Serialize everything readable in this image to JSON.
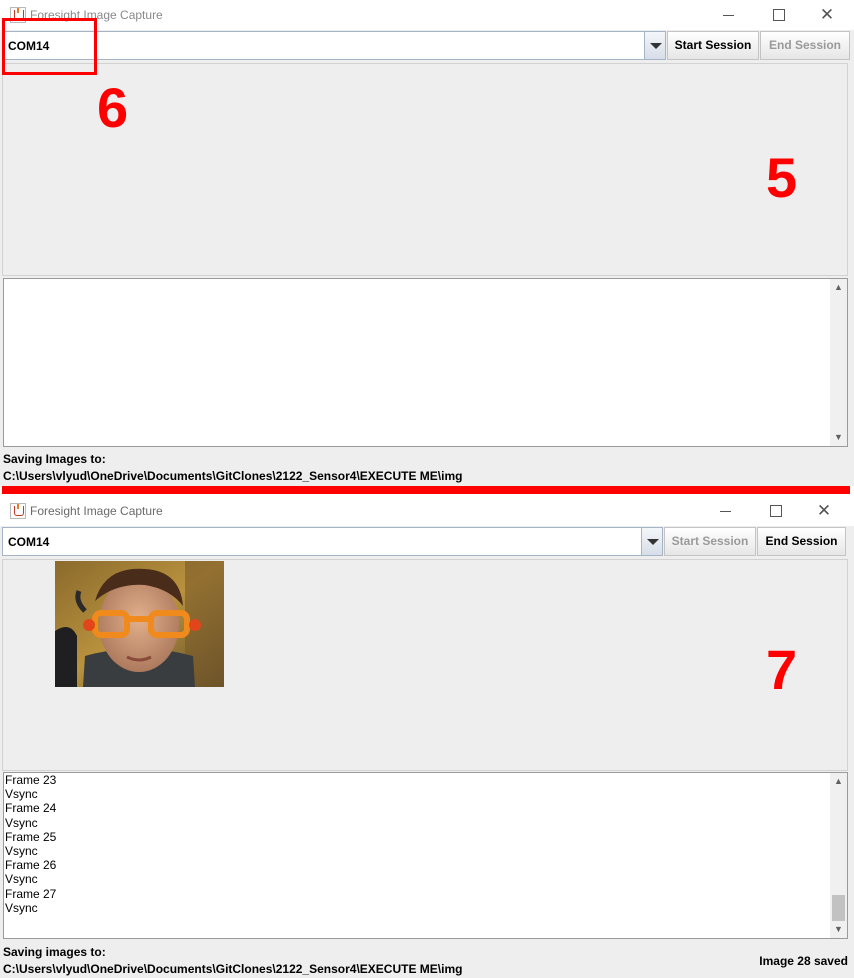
{
  "window_top": {
    "title": "Foresight Image Capture",
    "port_select": {
      "value": "COM14"
    },
    "start_button": "Start Session",
    "end_button": "End Session",
    "log_lines": [],
    "saving_label": "Saving Images to:",
    "saving_path": "C:\\Users\\vlyud\\OneDrive\\Documents\\GitClones\\2122_Sensor4\\EXECUTE ME\\img"
  },
  "window_bottom": {
    "title": "Foresight Image Capture",
    "port_select": {
      "value": "COM14"
    },
    "start_button": "Start Session",
    "end_button": "End Session",
    "log_lines": [
      "Frame 23",
      "Vsync",
      "Frame 24",
      "Vsync",
      "Frame 25",
      "Vsync",
      "Frame 26",
      "Vsync",
      "Frame 27",
      "Vsync"
    ],
    "saving_label": "Saving images to:",
    "saving_path": "C:\\Users\\vlyud\\OneDrive\\Documents\\GitClones\\2122_Sensor4\\EXECUTE ME\\img",
    "saved_count": "Image 28 saved"
  },
  "annotations": {
    "num_6": "6",
    "num_5": "5",
    "num_7": "7"
  },
  "colors": {
    "annotation_red": "#ff0000",
    "window_bg": "#eeeeee",
    "combo_border": "#a5b4c6",
    "disabled_text": "#9a9a9a"
  },
  "icons": {
    "app": "java-cup-icon",
    "minimize": "minimize-icon",
    "maximize": "maximize-icon",
    "close": "close-icon",
    "dropdown": "chevron-down-icon",
    "scroll_up": "scroll-up-icon",
    "scroll_down": "scroll-down-icon"
  }
}
